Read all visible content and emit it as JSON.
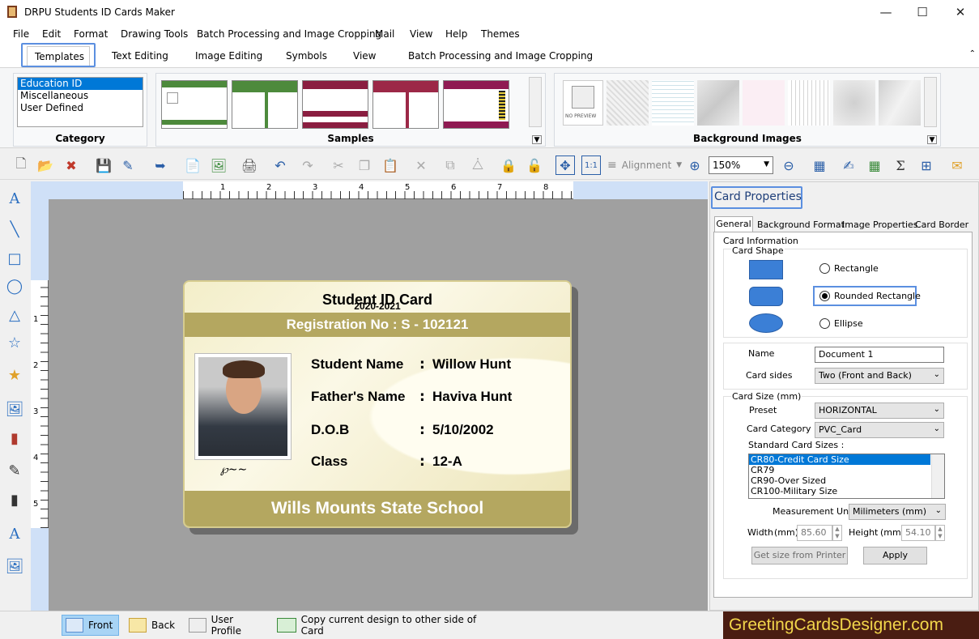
{
  "window": {
    "title": "DRPU Students ID Cards Maker"
  },
  "menu": [
    "File",
    "Edit",
    "Format",
    "Drawing Tools",
    "Batch Processing and Image Cropping",
    "Mail",
    "View",
    "Help",
    "Themes"
  ],
  "ribbon_tabs": [
    "Templates",
    "Text Editing",
    "Image Editing",
    "Symbols",
    "View",
    "Batch Processing and Image Cropping"
  ],
  "ribbon": {
    "category_label": "Category",
    "categories": [
      "Education ID",
      "Miscellaneous",
      "User Defined"
    ],
    "samples_label": "Samples",
    "background_label": "Background Images",
    "no_preview": "NO PREVIEW"
  },
  "toolbar": {
    "alignment_label": "Alignment",
    "zoom_value": "150%"
  },
  "ruler": {
    "h": [
      "1",
      "2",
      "3",
      "4",
      "5",
      "6",
      "7",
      "8"
    ],
    "v": [
      "1",
      "2",
      "3",
      "4",
      "5"
    ]
  },
  "card": {
    "title": "Student ID Card",
    "year": "2020-2021",
    "registration": "Registration No  :  S - 102121",
    "rows": [
      {
        "label": "Student Name",
        "value": "Willow Hunt"
      },
      {
        "label": "Father's Name",
        "value": "Haviva Hunt"
      },
      {
        "label": "D.O.B",
        "value": "5/10/2002"
      },
      {
        "label": "Class",
        "value": "12-A"
      }
    ],
    "colon": ":",
    "school": "Wills Mounts State School",
    "colors": {
      "band": "#b4a760",
      "bg": "#f7f3dc"
    }
  },
  "panel": {
    "title": "Card Properties",
    "tabs": [
      "General",
      "Background Format",
      "Image Properties",
      "Card Border"
    ],
    "card_information": "Card Information",
    "card_shape": "Card Shape",
    "shapes": [
      "Rectangle",
      "Rounded Rectangle",
      "Ellipse"
    ],
    "selected_shape": "Rounded Rectangle",
    "name_label": "Name",
    "name_value": "Document 1",
    "sides_label": "Card sides",
    "sides_value": "Two (Front and Back)",
    "size_label": "Card Size (mm)",
    "preset_label": "Preset",
    "preset_value": "HORIZONTAL",
    "category_label": "Card Category",
    "category_value": "PVC_Card",
    "standard_label": "Standard Card Sizes :",
    "standard_sizes": [
      "CR80-Credit Card Size",
      "CR79",
      "CR90-Over Sized",
      "CR100-Military Size"
    ],
    "unit_label": "Measurement Unit :",
    "unit_value": "Milimeters (mm)",
    "width_label": "Width",
    "width_unit": "(mm)",
    "width_value": "85.60",
    "height_label": "Height",
    "height_unit": "(mm)",
    "height_value": "54.10",
    "printer_button": "Get size from Printer",
    "apply_button": "Apply"
  },
  "status": {
    "front": "Front",
    "back": "Back",
    "profile": "User Profile",
    "copy": "Copy current design to other side of Card",
    "brand": "GreetingCardsDesigner.com"
  }
}
